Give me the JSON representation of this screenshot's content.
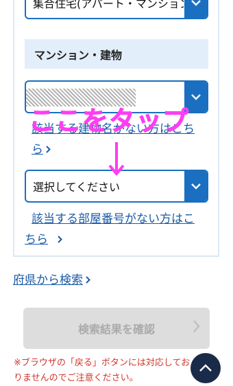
{
  "form": {
    "building_type": {
      "value": "集合住宅(アパート・マンション)"
    },
    "building_section": {
      "label": "マンション・建物"
    },
    "building_select": {
      "value": ""
    },
    "no_building_link": {
      "label": "該当する建物名がない方はこちら"
    },
    "room_select": {
      "value": "選択してください"
    },
    "no_room_link": {
      "label": "該当する部屋番号がない方はこちら"
    }
  },
  "annotation": {
    "text": "ここをタップ"
  },
  "prefecture_search_link": {
    "label": "府県から検索"
  },
  "confirm_button": {
    "label": "検索結果を確認"
  },
  "notice": {
    "text": "※ブラウザの「戻る」ボタンには対応しておりませんのでご注意ください。"
  },
  "colors": {
    "accent": "#1a6fc0",
    "link": "#1a5aa6",
    "annotation": "#ff3df2",
    "notice": "#d0342c"
  }
}
